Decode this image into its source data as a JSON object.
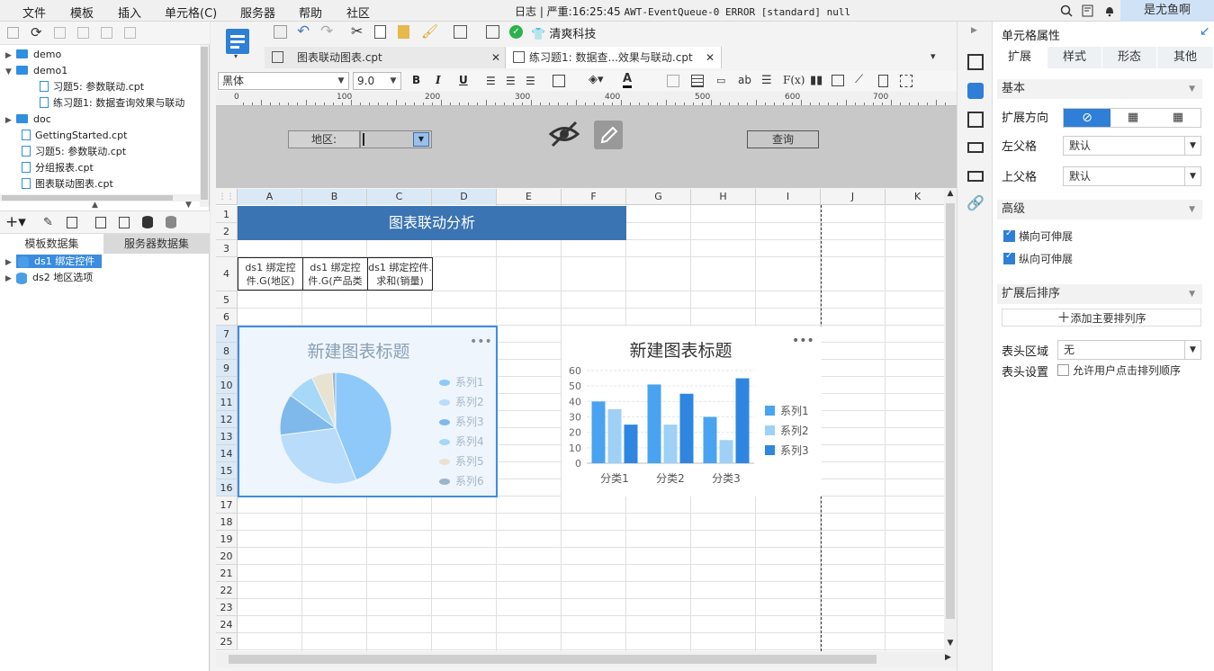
{
  "menu": [
    "文件",
    "模板",
    "插入",
    "单元格(C)",
    "服务器",
    "帮助",
    "社区"
  ],
  "log": {
    "prefix": "日志 | 严重:16:25:45",
    "message": "AWT-EventQueue-0 ERROR [standard] null"
  },
  "user": "是尤鱼啊",
  "tree": [
    {
      "label": "demo",
      "type": "folder",
      "level": 0
    },
    {
      "label": "demo1",
      "type": "folder",
      "level": 0,
      "expanded": true
    },
    {
      "label": "习题5: 参数联动.cpt",
      "type": "file",
      "level": 1
    },
    {
      "label": "练习题1: 数据查询效果与联动",
      "type": "file",
      "level": 1
    },
    {
      "label": "doc",
      "type": "folder",
      "level": 0
    },
    {
      "label": "GettingStarted.cpt",
      "type": "file",
      "level": 0
    },
    {
      "label": "习题5: 参数联动.cpt",
      "type": "file",
      "level": 0
    },
    {
      "label": "分组报表.cpt",
      "type": "file",
      "level": 0
    },
    {
      "label": "图表联动图表.cpt",
      "type": "file",
      "level": 0
    }
  ],
  "dataset_tabs": [
    "模板数据集",
    "服务器数据集"
  ],
  "datasets": [
    {
      "label": "ds1 绑定控件",
      "selected": true
    },
    {
      "label": "ds2 地区选项",
      "selected": false
    }
  ],
  "toolbar": {
    "brand_label": "清爽科技"
  },
  "file_tabs": [
    {
      "label": "图表联动图表.cpt",
      "active": false
    },
    {
      "label": "练习题1: 数据查...效果与联动.cpt",
      "active": true
    }
  ],
  "format": {
    "font": "黑体",
    "size": "9.0",
    "bold": "B",
    "italic": "I",
    "underline": "U"
  },
  "ruler": [
    "0",
    "100",
    "200",
    "300",
    "400",
    "500",
    "600",
    "700"
  ],
  "params": {
    "region_label": "地区:",
    "query_label": "查询"
  },
  "columns": [
    "A",
    "B",
    "C",
    "D",
    "E",
    "F",
    "G",
    "H",
    "I",
    "J",
    "K"
  ],
  "rows": [
    "1",
    "2",
    "3",
    "4",
    "5",
    "6",
    "7",
    "8",
    "9",
    "10",
    "11",
    "12",
    "13",
    "14",
    "15",
    "16",
    "17",
    "18",
    "19",
    "20",
    "21",
    "22",
    "23",
    "24",
    "25"
  ],
  "sheet": {
    "title": "图表联动分析",
    "headers": [
      "ds1 绑定控件.G(地区)",
      "ds1 绑定控件.G(产品类型)",
      "ds1 绑定控件.求和(销量)"
    ]
  },
  "pie_chart": {
    "title": "新建图表标题",
    "legend": [
      "系列1",
      "系列2",
      "系列3",
      "系列4",
      "系列5",
      "系列6"
    ],
    "colors": [
      "#8ec9f9",
      "#b8dcf9",
      "#7fb8ea",
      "#a6d8f7",
      "#e8e2d0",
      "#9ab6c8"
    ]
  },
  "chart_data": [
    {
      "type": "pie",
      "title": "新建图表标题",
      "categories": [
        "系列1",
        "系列2",
        "系列3",
        "系列4",
        "系列5",
        "系列6"
      ],
      "values": [
        44,
        29,
        12,
        8,
        6,
        1
      ]
    },
    {
      "type": "bar",
      "title": "新建图表标题",
      "categories": [
        "分类1",
        "分类2",
        "分类3"
      ],
      "series": [
        {
          "name": "系列1",
          "values": [
            40,
            51,
            30
          ]
        },
        {
          "name": "系列2",
          "values": [
            35,
            25,
            15
          ]
        },
        {
          "name": "系列3",
          "values": [
            25,
            45,
            55
          ]
        }
      ],
      "ylim": [
        0,
        60
      ],
      "yticks": [
        "0",
        "10",
        "20",
        "30",
        "40",
        "50",
        "60"
      ],
      "colors": [
        "#4aa3f0",
        "#9fd0f5",
        "#2f86e0"
      ]
    }
  ],
  "props": {
    "panel_title": "单元格属性",
    "tabs": [
      "扩展",
      "样式",
      "形态",
      "其他"
    ],
    "basic": "基本",
    "expand_dir": "扩展方向",
    "left_parent": "左父格",
    "left_parent_val": "默认",
    "top_parent": "上父格",
    "top_parent_val": "默认",
    "advanced": "高级",
    "h_extend": "横向可伸展",
    "v_extend": "纵向可伸展",
    "sort_section": "扩展后排序",
    "add_sort": "添加主要排列序",
    "header_area": "表头区域",
    "header_area_val": "无",
    "header_setting": "表头设置",
    "allow_sort": "允许用户点击排列顺序"
  }
}
